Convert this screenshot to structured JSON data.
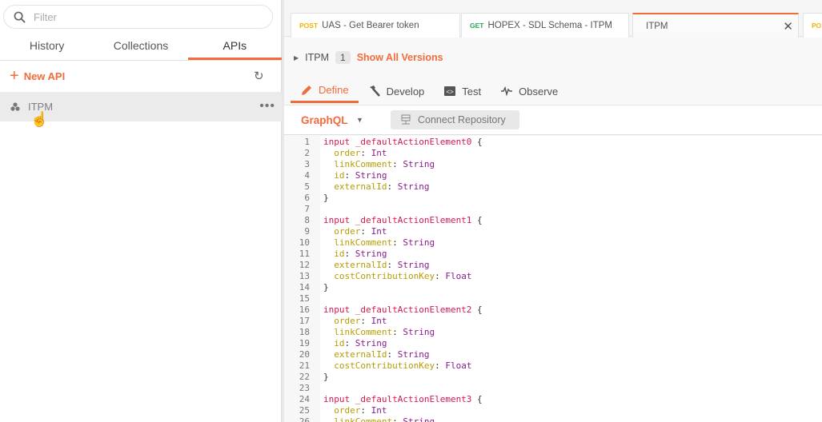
{
  "sidebar": {
    "filter_placeholder": "Filter",
    "tabs": [
      {
        "label": "History"
      },
      {
        "label": "Collections"
      },
      {
        "label": "APIs",
        "active": true
      }
    ],
    "new_api_label": "New API",
    "apis": [
      {
        "name": "ITPM"
      }
    ]
  },
  "tabs": [
    {
      "method": "POST",
      "method_color": "#f4b400",
      "title": "UAS - Get Bearer token"
    },
    {
      "method": "GET",
      "method_color": "#26a653",
      "title": "HOPEX - SDL Schema - ITPM"
    },
    {
      "method": "",
      "title": "ITPM",
      "active": true
    },
    {
      "method": "PO",
      "method_color": "#f4b400",
      "title": ""
    }
  ],
  "version": {
    "api_name": "ITPM",
    "version": "1",
    "show_all_label": "Show All Versions"
  },
  "define_tabs": [
    {
      "label": "Define",
      "active": true
    },
    {
      "label": "Develop"
    },
    {
      "label": "Test"
    },
    {
      "label": "Observe"
    }
  ],
  "toolbar": {
    "schema_type": "GraphQL",
    "connect_label": "Connect Repository"
  },
  "accent_color": "#f26b3a",
  "code": [
    [
      "input _defaultActionElement0 {"
    ],
    [
      "order",
      "Int"
    ],
    [
      "linkComment",
      "String"
    ],
    [
      "id",
      "String"
    ],
    [
      "externalId",
      "String"
    ],
    [
      "}"
    ],
    [
      ""
    ],
    [
      "input _defaultActionElement1 {"
    ],
    [
      "order",
      "Int"
    ],
    [
      "linkComment",
      "String"
    ],
    [
      "id",
      "String"
    ],
    [
      "externalId",
      "String"
    ],
    [
      "costContributionKey",
      "Float"
    ],
    [
      "}"
    ],
    [
      ""
    ],
    [
      "input _defaultActionElement2 {"
    ],
    [
      "order",
      "Int"
    ],
    [
      "linkComment",
      "String"
    ],
    [
      "id",
      "String"
    ],
    [
      "externalId",
      "String"
    ],
    [
      "costContributionKey",
      "Float"
    ],
    [
      "}"
    ],
    [
      ""
    ],
    [
      "input _defaultActionElement3 {"
    ],
    [
      "order",
      "Int"
    ],
    [
      "linkComment",
      "String"
    ]
  ]
}
